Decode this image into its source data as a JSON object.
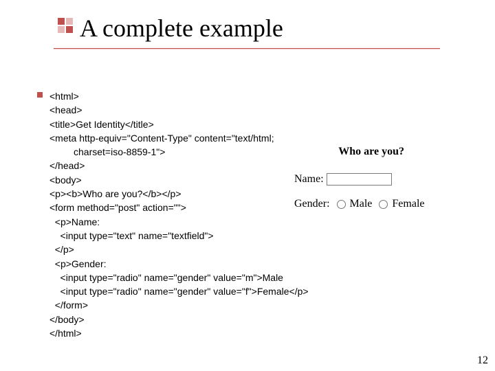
{
  "header": {
    "title": "A complete example"
  },
  "code": {
    "lines": [
      "<html>",
      "<head>",
      "<title>Get Identity</title>",
      "<meta http-equiv=\"Content-Type\" content=\"text/html;",
      "         charset=iso-8859-1\">",
      "</head>",
      "<body>",
      "<p><b>Who are you?</b></p>",
      "<form method=\"post\" action=\"\">",
      "  <p>Name:",
      "    <input type=\"text\" name=\"textfield\">",
      "  </p>",
      "  <p>Gender:",
      "    <input type=\"radio\" name=\"gender\" value=\"m\">Male",
      "    <input type=\"radio\" name=\"gender\" value=\"f\">Female</p>",
      "  </form>",
      "</body>",
      "</html>"
    ]
  },
  "preview": {
    "heading": "Who are you?",
    "name_label": "Name:",
    "gender_label": "Gender:",
    "male_label": "Male",
    "female_label": "Female"
  },
  "page_number": "12"
}
